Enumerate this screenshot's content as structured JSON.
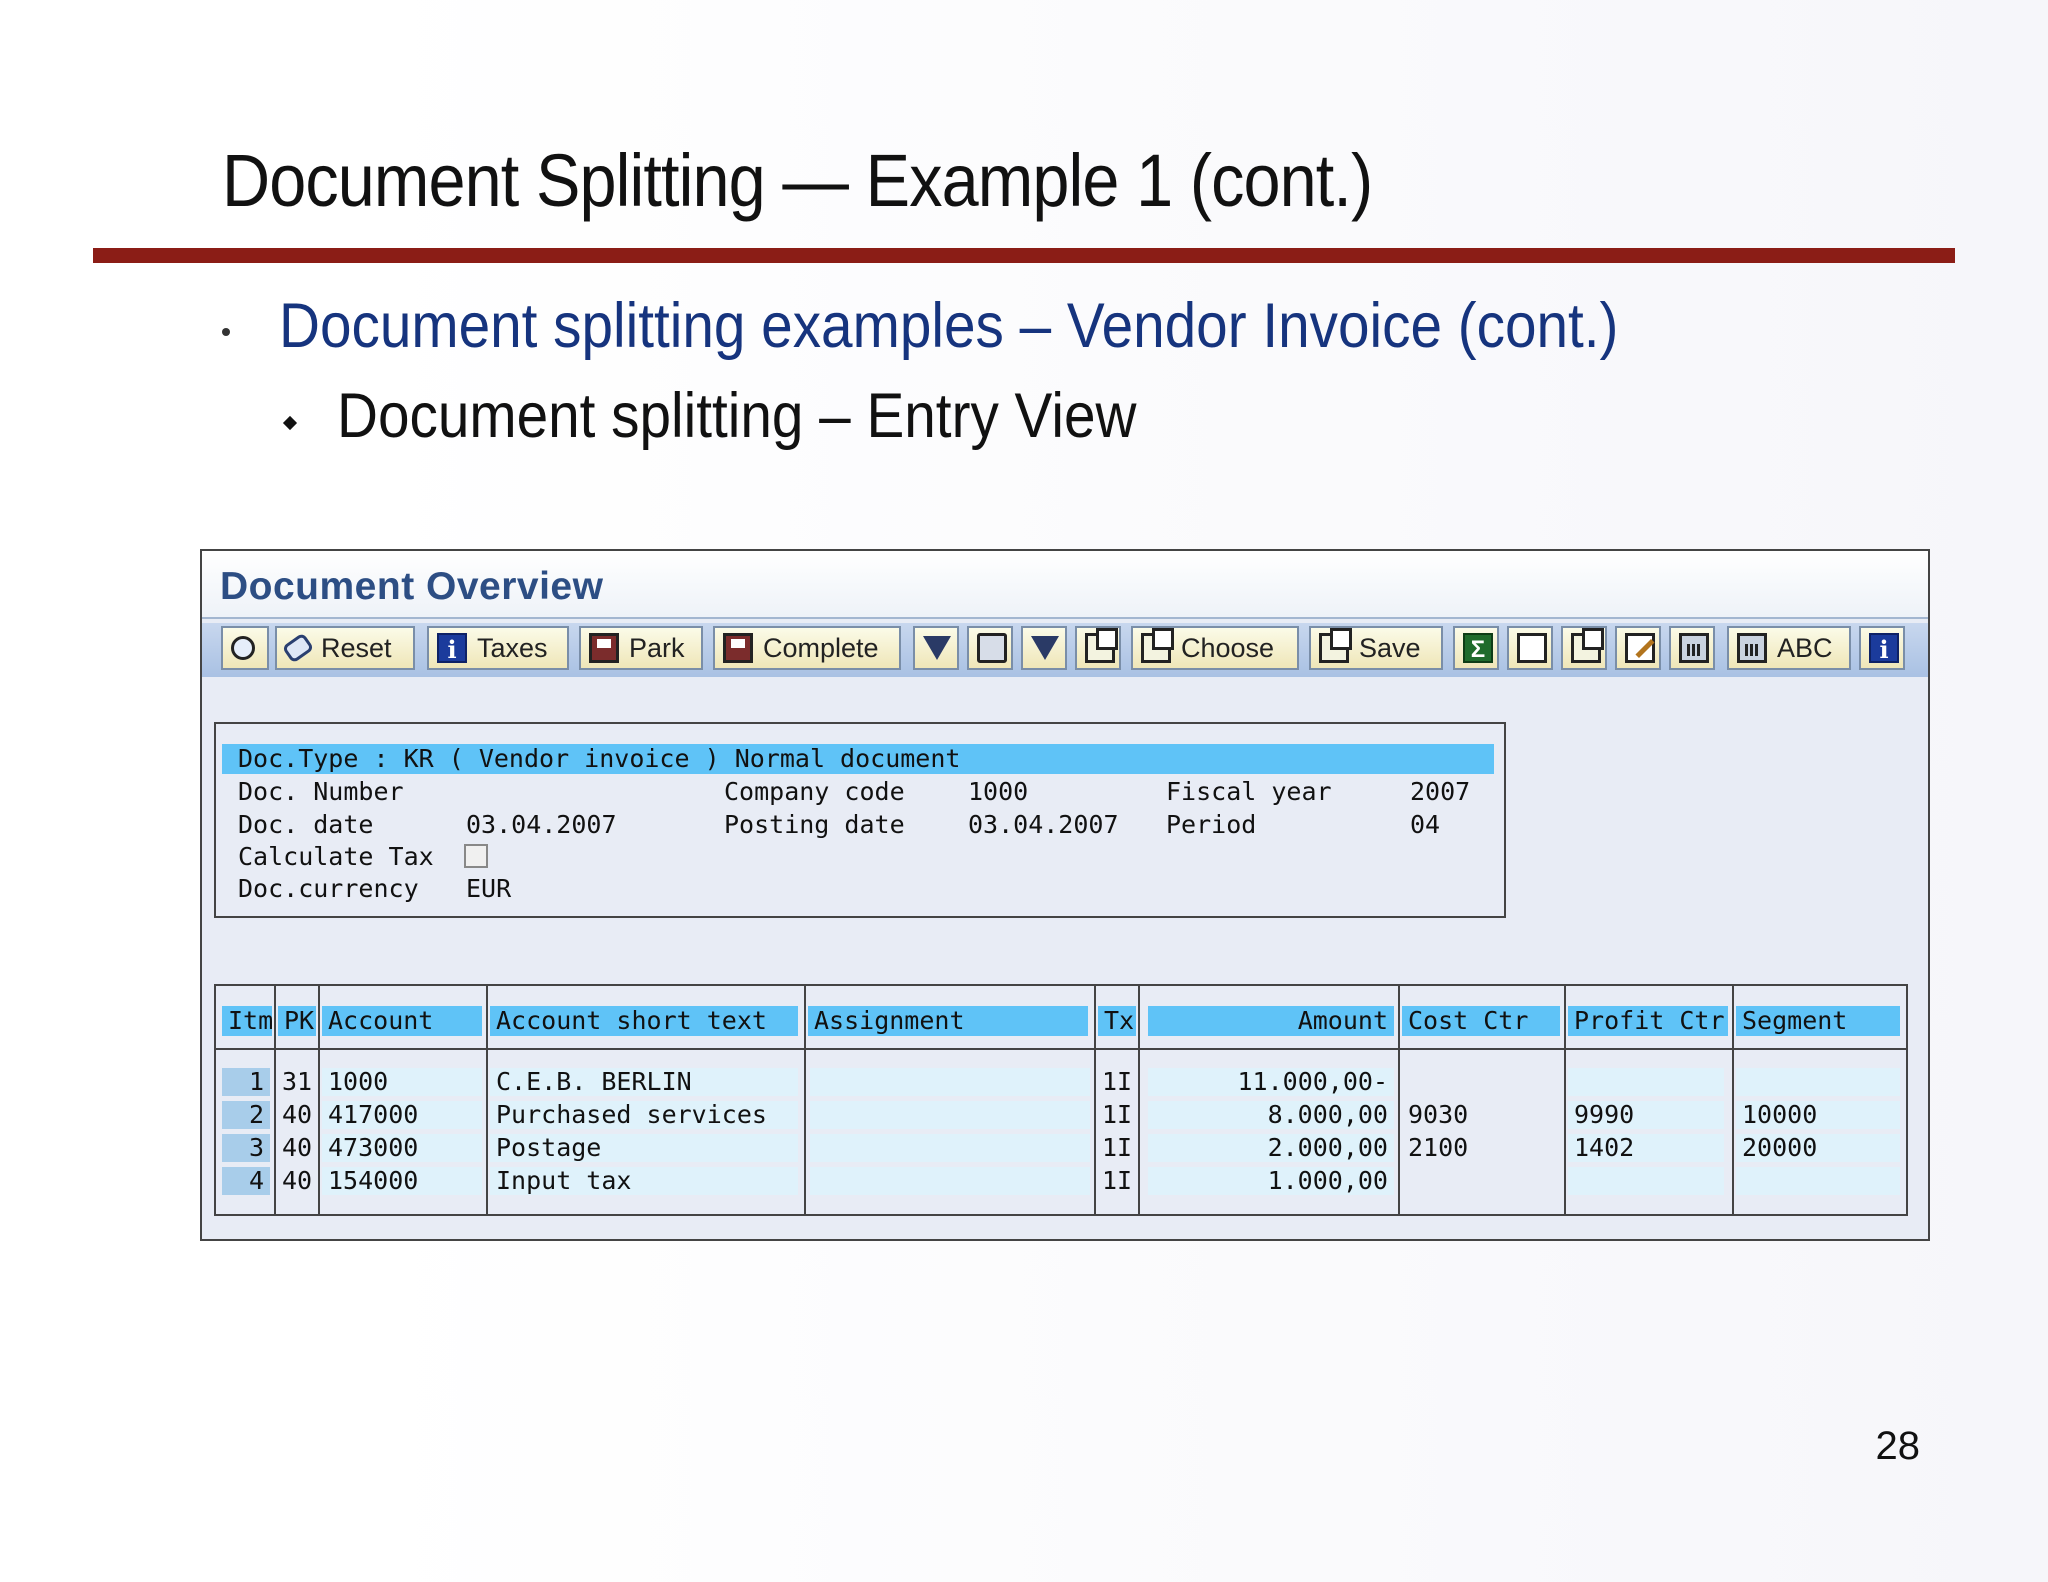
{
  "slide": {
    "title": "Document Splitting — Example 1 (cont.)",
    "bullet1": "Document splitting examples – Vendor Invoice (cont.)",
    "bullet2": "Document splitting – Entry View",
    "page_number": "28",
    "rule_color": "#8b1d16",
    "bullet1_color": "#16347e"
  },
  "sap": {
    "window_title": "Document Overview",
    "toolbar": [
      {
        "icon": "display-icon",
        "label": ""
      },
      {
        "icon": "reset-icon",
        "label": "Reset"
      },
      {
        "icon": "info-icon",
        "label": "Taxes"
      },
      {
        "icon": "park-disk-icon",
        "label": "Park"
      },
      {
        "icon": "save-disk-icon",
        "label": "Complete"
      },
      {
        "icon": "filter-icon",
        "label": ""
      },
      {
        "icon": "print-icon",
        "label": ""
      },
      {
        "icon": "set-filter-icon",
        "label": ""
      },
      {
        "icon": "copy-layout-icon",
        "label": ""
      },
      {
        "icon": "choose-layout-icon",
        "label": "Choose"
      },
      {
        "icon": "save-layout-icon",
        "label": "Save"
      },
      {
        "icon": "sum-icon",
        "label": ""
      },
      {
        "icon": "delete-doc-icon",
        "label": ""
      },
      {
        "icon": "export-icon",
        "label": ""
      },
      {
        "icon": "edit-icon",
        "label": ""
      },
      {
        "icon": "calculator-icon",
        "label": ""
      },
      {
        "icon": "calculator-abc-icon",
        "label": "ABC"
      },
      {
        "icon": "info-icon",
        "label": ""
      }
    ],
    "header": {
      "doc_type_line": "Doc.Type : KR ( Vendor invoice ) Normal document",
      "doc_number_label": "Doc. Number",
      "doc_number_value": "",
      "company_code_label": "Company code",
      "company_code_value": "1000",
      "fiscal_year_label": "Fiscal year",
      "fiscal_year_value": "2007",
      "doc_date_label": "Doc. date",
      "doc_date_value": "03.04.2007",
      "posting_date_label": "Posting date",
      "posting_date_value": "03.04.2007",
      "period_label": "Period",
      "period_value": "04",
      "calculate_tax_label": "Calculate Tax",
      "calculate_tax_checked": false,
      "doc_currency_label": "Doc.currency",
      "doc_currency_value": "EUR"
    },
    "table": {
      "columns": [
        "Itm",
        "PK",
        "Account",
        "Account short text",
        "Assignment",
        "Tx",
        "Amount",
        "Cost Ctr",
        "Profit Ctr",
        "Segment"
      ],
      "rows": [
        {
          "itm": "1",
          "pk": "31",
          "account": "1000",
          "text": "C.E.B. BERLIN",
          "assignment": "",
          "tx": "1I",
          "amount": "11.000,00-",
          "cost_ctr": "",
          "profit_ctr": "",
          "segment": ""
        },
        {
          "itm": "2",
          "pk": "40",
          "account": "417000",
          "text": "Purchased services",
          "assignment": "",
          "tx": "1I",
          "amount": "8.000,00",
          "cost_ctr": "9030",
          "profit_ctr": "9990",
          "segment": "10000"
        },
        {
          "itm": "3",
          "pk": "40",
          "account": "473000",
          "text": "Postage",
          "assignment": "",
          "tx": "1I",
          "amount": "2.000,00",
          "cost_ctr": "2100",
          "profit_ctr": "1402",
          "segment": "20000"
        },
        {
          "itm": "4",
          "pk": "40",
          "account": "154000",
          "text": "Input tax",
          "assignment": "",
          "tx": "1I",
          "amount": "1.000,00",
          "cost_ctr": "",
          "profit_ctr": "",
          "segment": ""
        }
      ]
    }
  }
}
